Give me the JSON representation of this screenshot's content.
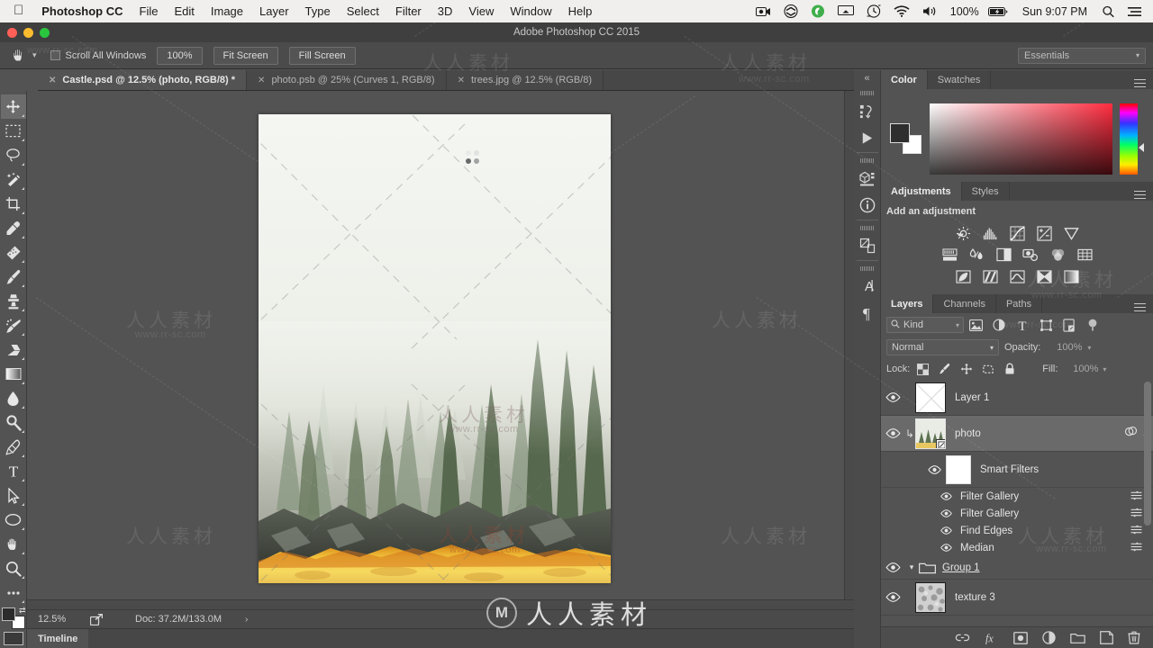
{
  "menubar": {
    "apple": "",
    "app_name": "Photoshop CC",
    "items": [
      "File",
      "Edit",
      "Image",
      "Layer",
      "Type",
      "Select",
      "Filter",
      "3D",
      "View",
      "Window",
      "Help"
    ],
    "battery_percent": "100%",
    "clock": "Sun 9:07 PM",
    "status_icons": [
      "screen-recording-icon",
      "dropbox-icon",
      "evernote-icon",
      "airplay-icon",
      "timemachine-icon",
      "wifi-icon",
      "volume-icon",
      "battery-icon",
      "spotlight-search-icon",
      "notification-center-icon"
    ]
  },
  "window": {
    "title": "Adobe Photoshop CC 2015"
  },
  "options_bar": {
    "tool_icon": "hand-tool-icon",
    "scroll_all_windows": "Scroll All Windows",
    "scroll_all_windows_checked": false,
    "buttons": [
      "100%",
      "Fit Screen",
      "Fill Screen"
    ],
    "workspace": "Essentials"
  },
  "tabs": [
    {
      "label": "Castle.psd @ 12.5% (photo, RGB/8) *",
      "active": true
    },
    {
      "label": "photo.psb @ 25% (Curves 1, RGB/8)",
      "active": false
    },
    {
      "label": "trees.jpg @ 12.5% (RGB/8)",
      "active": false
    }
  ],
  "toolbox": [
    {
      "name": "move-tool",
      "selected": true
    },
    {
      "name": "rectangular-marquee-tool",
      "selected": false
    },
    {
      "name": "lasso-tool",
      "selected": false
    },
    {
      "name": "quick-selection-tool",
      "selected": false
    },
    {
      "name": "crop-tool",
      "selected": false
    },
    {
      "name": "eyedropper-tool",
      "selected": false
    },
    {
      "name": "spot-healing-brush-tool",
      "selected": false
    },
    {
      "name": "brush-tool",
      "selected": false
    },
    {
      "name": "clone-stamp-tool",
      "selected": false
    },
    {
      "name": "history-brush-tool",
      "selected": false
    },
    {
      "name": "eraser-tool",
      "selected": false
    },
    {
      "name": "gradient-tool",
      "selected": false
    },
    {
      "name": "blur-tool",
      "selected": false
    },
    {
      "name": "dodge-tool",
      "selected": false
    },
    {
      "name": "pen-tool",
      "selected": false
    },
    {
      "name": "horizontal-type-tool",
      "selected": false
    },
    {
      "name": "path-selection-tool",
      "selected": false
    },
    {
      "name": "ellipse-tool",
      "selected": false
    },
    {
      "name": "hand-tool",
      "selected": false
    },
    {
      "name": "zoom-tool",
      "selected": false
    },
    {
      "name": "edit-toolbar-tool",
      "selected": false
    }
  ],
  "status_bar": {
    "zoom": "12.5%",
    "doc_info": "Doc: 37.2M/133.0M",
    "share_icon": "share-icon",
    "arrow": "›"
  },
  "timeline": {
    "label": "Timeline"
  },
  "rail": [
    "history-icon",
    "actions-play-icon",
    "3d-icon",
    "info-icon",
    "libraries-icon",
    "character-icon",
    "paragraph-icon"
  ],
  "color_panel": {
    "tabs": [
      {
        "label": "Color",
        "active": true
      },
      {
        "label": "Swatches",
        "active": false
      }
    ],
    "foreground": "#2e2e2e",
    "background": "#ffffff",
    "field_hue": "#ff2d40"
  },
  "adjustments_panel": {
    "tabs": [
      {
        "label": "Adjustments",
        "active": true
      },
      {
        "label": "Styles",
        "active": false
      }
    ],
    "heading": "Add an adjustment",
    "row1": [
      "brightness-contrast-icon",
      "levels-icon",
      "curves-icon",
      "exposure-icon",
      "vibrance-icon"
    ],
    "row2": [
      "hue-saturation-icon",
      "color-balance-icon",
      "black-white-icon",
      "photo-filter-icon",
      "channel-mixer-icon",
      "color-lookup-icon"
    ],
    "row3": [
      "invert-icon",
      "posterize-icon",
      "threshold-icon",
      "gradient-map-icon",
      "selective-color-icon"
    ]
  },
  "layers_panel": {
    "tabs": [
      {
        "label": "Layers",
        "active": true
      },
      {
        "label": "Channels",
        "active": false
      },
      {
        "label": "Paths",
        "active": false
      }
    ],
    "filter": {
      "kind_label": "Kind",
      "search_icon": "search-icon",
      "type_filters": [
        "pixel-layer-filter-icon",
        "adjustment-layer-filter-icon",
        "type-layer-filter-icon",
        "shape-layer-filter-icon",
        "smart-object-filter-icon"
      ],
      "toggle_icon": "filter-toggle-icon"
    },
    "blend_mode": "Normal",
    "opacity_label": "Opacity:",
    "opacity_value": "100%",
    "lock_label": "Lock:",
    "lock_icons": [
      "lock-transparent-pixels-icon",
      "lock-image-pixels-icon",
      "lock-position-icon",
      "lock-artboard-icon",
      "lock-all-icon"
    ],
    "fill_label": "Fill:",
    "fill_value": "100%",
    "rows": [
      {
        "type": "layer",
        "name": "Layer 1",
        "visible": true,
        "selected": false,
        "clipped": false,
        "thumb": "white-thumb"
      },
      {
        "type": "layer",
        "name": "photo",
        "visible": true,
        "selected": true,
        "clipped": true,
        "thumb": "forest-thumb",
        "right_icon": "smart-object-fx-icon",
        "collapse": "chevron-up-icon"
      },
      {
        "type": "smart-filters",
        "name": "Smart Filters",
        "visible": true,
        "thumb": "white-mask-thumb"
      },
      {
        "type": "filter",
        "name": "Filter Gallery",
        "visible": true
      },
      {
        "type": "filter",
        "name": "Filter Gallery",
        "visible": true
      },
      {
        "type": "filter",
        "name": "Find Edges",
        "visible": true
      },
      {
        "type": "filter",
        "name": "Median",
        "visible": true
      },
      {
        "type": "group",
        "name": "Group 1",
        "visible": true,
        "expanded": true
      },
      {
        "type": "layer",
        "name": "texture 3",
        "visible": true,
        "selected": false,
        "thumb": "texture-thumb"
      }
    ],
    "bottom_icons": [
      "link-layers-icon",
      "add-layer-style-icon",
      "add-layer-mask-icon",
      "new-adjustment-layer-icon",
      "new-group-icon",
      "new-layer-icon",
      "delete-layer-icon"
    ]
  },
  "watermark": {
    "cjk": "人人素材",
    "url": "www.rr-sc.com",
    "center_logo": "M",
    "center_text": "人人素材"
  },
  "canvas": {
    "document_title": "Castle.psd",
    "spinner": "loading-spinner-icon"
  },
  "colors": {
    "window_bg": "#535353",
    "panel_bg": "#535353",
    "dark_bg": "#454545",
    "accent_blue": "#1473e6",
    "text": "#d2d2d2"
  }
}
